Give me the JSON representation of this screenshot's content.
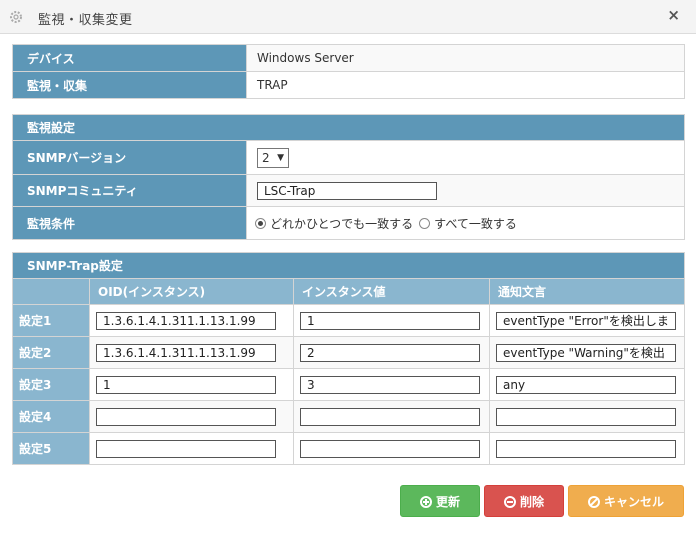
{
  "window": {
    "title": "監視・収集変更",
    "close": "×"
  },
  "device": {
    "rows": [
      {
        "label": "デバイス",
        "value": "Windows Server"
      },
      {
        "label": "監視・収集",
        "value": "TRAP"
      }
    ]
  },
  "monitor": {
    "header": "監視設定",
    "snmp_version": {
      "label": "SNMPバージョン",
      "value": "2"
    },
    "snmp_community": {
      "label": "SNMPコミュニティ",
      "value": "LSC-Trap"
    },
    "condition": {
      "label": "監視条件",
      "options": [
        {
          "label": "どれかひとつでも一致する",
          "selected": true
        },
        {
          "label": "すべて一致する",
          "selected": false
        }
      ]
    }
  },
  "trap": {
    "header": "SNMP-Trap設定",
    "columns": [
      "OID(インスタンス)",
      "インスタンス値",
      "通知文言"
    ],
    "rows": [
      {
        "label": "設定1",
        "oid": "1.3.6.1.4.1.311.1.13.1.99",
        "instance": "1",
        "message": "eventType \"Error\"を検出しま"
      },
      {
        "label": "設定2",
        "oid": "1.3.6.1.4.1.311.1.13.1.99",
        "instance": "2",
        "message": "eventType \"Warning\"を検出"
      },
      {
        "label": "設定3",
        "oid": "1",
        "instance": "3",
        "message": "any"
      },
      {
        "label": "設定4",
        "oid": "",
        "instance": "",
        "message": ""
      },
      {
        "label": "設定5",
        "oid": "",
        "instance": "",
        "message": ""
      }
    ]
  },
  "buttons": {
    "update": "更新",
    "delete": "削除",
    "cancel": "キャンセル"
  },
  "colors": {
    "header": "#5d97b7",
    "subheader": "#8ab6cf",
    "update": "#5cb85c",
    "delete": "#d9534f",
    "cancel": "#f0ad4e"
  }
}
